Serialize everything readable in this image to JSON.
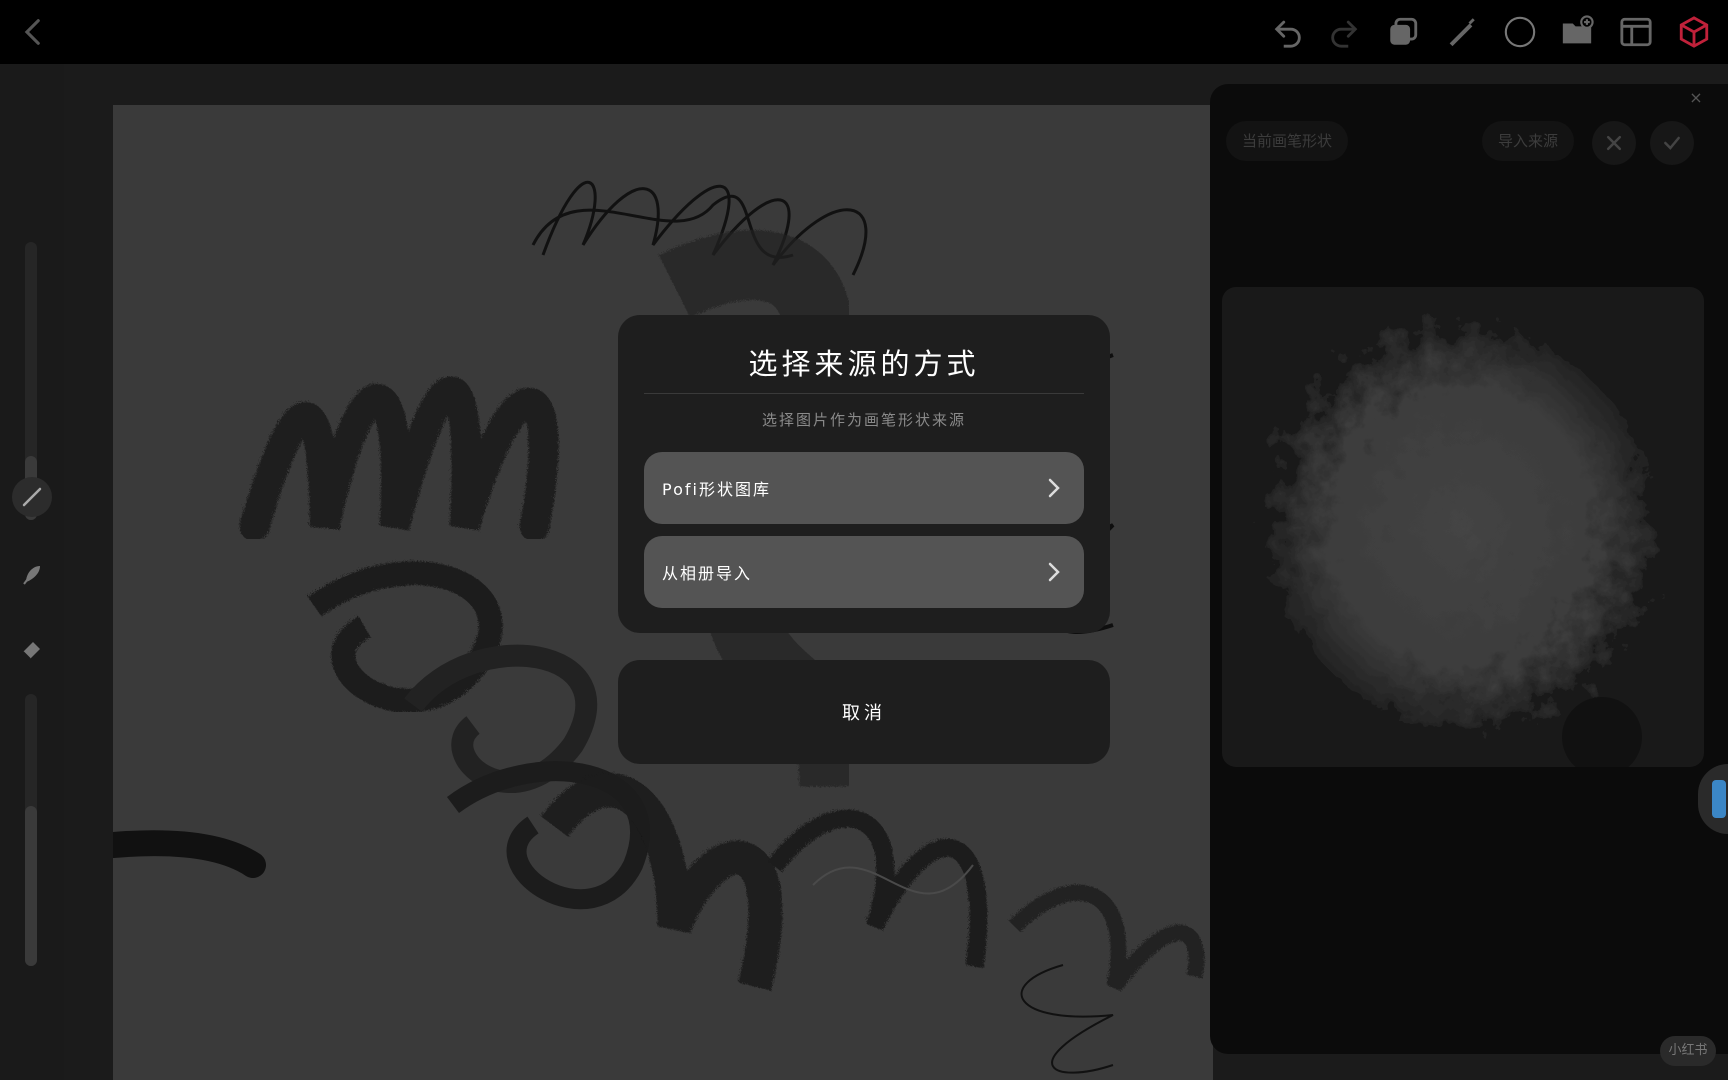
{
  "toolbar": {
    "icons": [
      "back-icon",
      "undo-icon",
      "redo-icon",
      "layers-icon",
      "pen-icon",
      "color-circle-icon",
      "folder-add-icon",
      "gallery-icon",
      "app-logo-icon"
    ]
  },
  "panel": {
    "current_shape_label": "当前画笔形状",
    "import_source_label": "导入来源",
    "close_glyph": "×"
  },
  "dialog": {
    "title": "选择来源的方式",
    "subtitle": "选择图片作为画笔形状来源",
    "options": [
      {
        "label": "Pofi形状图库"
      },
      {
        "label": "从相册导入"
      }
    ],
    "cancel_label": "取消"
  },
  "watermark": "小红书",
  "colors": {
    "accent": "#3b86c5",
    "logo": "#c0213a"
  }
}
